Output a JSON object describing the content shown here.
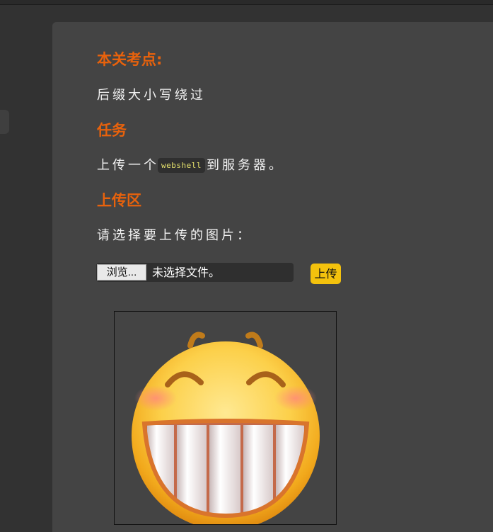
{
  "sections": {
    "checkpoint": {
      "title": "本关考点:",
      "text": "后缀大小写绕过"
    },
    "task": {
      "title": "任务",
      "text_before": "上传一个",
      "code": "webshell",
      "text_after": "到服务器。"
    },
    "upload": {
      "title": "上传区",
      "prompt": "请选择要上传的图片：",
      "browse_label": "浏览...",
      "file_status": "未选择文件。",
      "submit_label": "上传"
    }
  },
  "preview": {
    "icon": "grinning-face-icon"
  },
  "colors": {
    "background": "#323232",
    "panel": "#444444",
    "heading": "#e8620c",
    "upload_button": "#f4c20d",
    "code_text": "#e7e36d"
  }
}
